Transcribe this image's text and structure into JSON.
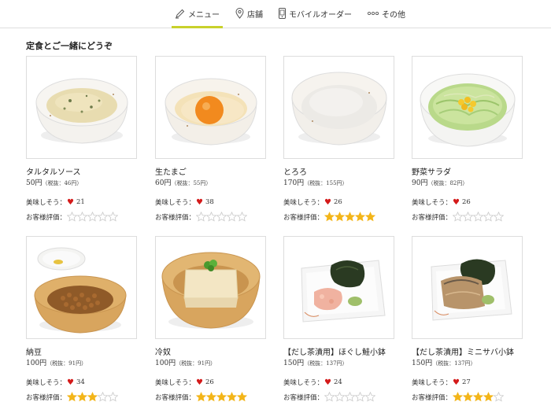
{
  "nav": {
    "items": [
      {
        "label": "メニュー",
        "icon": "pencil-icon",
        "active": true
      },
      {
        "label": "店舗",
        "icon": "location-pin-icon",
        "active": false
      },
      {
        "label": "モバイルオーダー",
        "icon": "smartphone-icon",
        "active": false
      },
      {
        "label": "その他",
        "icon": "more-dots-icon",
        "active": false
      }
    ],
    "accent_color": "#c8d12b"
  },
  "section": {
    "title": "定食とご一緒にどうぞ"
  },
  "labels": {
    "likes": "美味しそう：",
    "rating": "お客様評価："
  },
  "colors": {
    "heart": "#d41a1a",
    "star_filled": "#f3b519",
    "star_empty": "#c9c9c9"
  },
  "products": [
    {
      "name": "タルタルソース",
      "price": "50円",
      "tax": "（税抜：46円）",
      "likes": "21",
      "rating": 0,
      "image": "tartar-sauce-bowl"
    },
    {
      "name": "生たまご",
      "price": "60円",
      "tax": "（税抜：55円）",
      "likes": "38",
      "rating": 0,
      "image": "raw-egg-bowl"
    },
    {
      "name": "とろろ",
      "price": "170円",
      "tax": "（税抜：155円）",
      "likes": "26",
      "rating": 5,
      "image": "grated-yam-bowl"
    },
    {
      "name": "野菜サラダ",
      "price": "90円",
      "tax": "（税抜：82円）",
      "likes": "26",
      "rating": 0,
      "image": "salad-bowl"
    },
    {
      "name": "納豆",
      "price": "100円",
      "tax": "（税抜：91円）",
      "likes": "34",
      "rating": 3,
      "image": "natto-bowl"
    },
    {
      "name": "冷奴",
      "price": "100円",
      "tax": "（税抜：91円）",
      "likes": "26",
      "rating": 5,
      "image": "cold-tofu-bowl"
    },
    {
      "name": "【だし茶漬用】ほぐし鮭小鉢",
      "price": "150円",
      "tax": "（税抜：137円）",
      "likes": "24",
      "rating": 0,
      "image": "salmon-flakes-plate"
    },
    {
      "name": "【だし茶漬用】ミニサバ小鉢",
      "price": "150円",
      "tax": "（税抜：137円）",
      "likes": "27",
      "rating": 4,
      "image": "mackerel-plate"
    }
  ]
}
